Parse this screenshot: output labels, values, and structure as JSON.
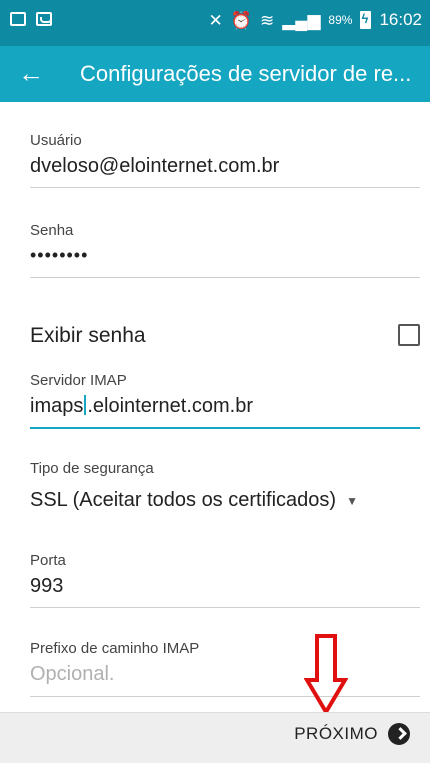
{
  "status_bar": {
    "time": "16:02",
    "battery_percent": "89%",
    "left_icons": [
      "image-icon",
      "voicemail-icon"
    ],
    "right_icons": [
      "mute-icon",
      "alarm-icon",
      "wifi-icon",
      "signal-icon",
      "battery-charging-icon"
    ]
  },
  "app_bar": {
    "title": "Configurações de servidor de re...",
    "back_icon": "arrow-left-icon",
    "background": "#15a6c2"
  },
  "form": {
    "user": {
      "label": "Usuário",
      "value": "dveloso@elointernet.com.br"
    },
    "password": {
      "label": "Senha",
      "value": "••••••••"
    },
    "show_password": {
      "label": "Exibir senha",
      "checked": false
    },
    "imap_server": {
      "label": "Servidor IMAP",
      "value_before_cursor": "imaps",
      "value_after_cursor": ".elointernet.com.br"
    },
    "security_type": {
      "label": "Tipo de segurança",
      "selected": "SSL (Aceitar todos os certificados)"
    },
    "port": {
      "label": "Porta",
      "value": "993"
    },
    "imap_prefix": {
      "label": "Prefixo de caminho IMAP",
      "placeholder": "Opcional."
    }
  },
  "footer": {
    "next_label": "PRÓXIMO",
    "next_icon": "chevron-right-circle-icon"
  },
  "annotation": {
    "arrow_color": "#e01010"
  }
}
